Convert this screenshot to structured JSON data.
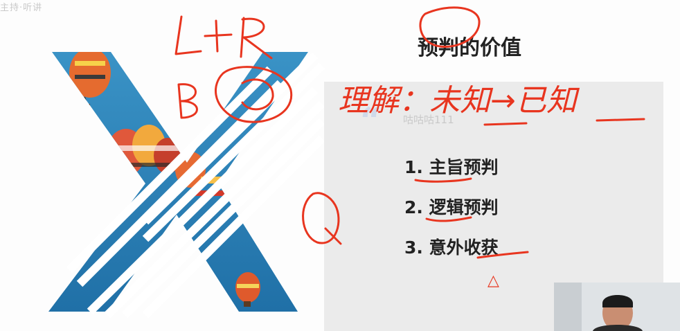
{
  "watermark": {
    "text": "主持·听讲"
  },
  "slide": {
    "title": "预判的价值",
    "handle": "咕咕咕111",
    "items": [
      "1. 主旨预判",
      "2. 逻辑预判",
      "3. 意外收获"
    ]
  },
  "annotations": {
    "top_left": "L+R",
    "middle": "理解：未知→已知",
    "left_letter": "Q",
    "small_mark": "△"
  },
  "colors": {
    "ink": "#e8351f",
    "sky": "#2f87bd",
    "panel": "#ebebeb",
    "text": "#222222"
  }
}
